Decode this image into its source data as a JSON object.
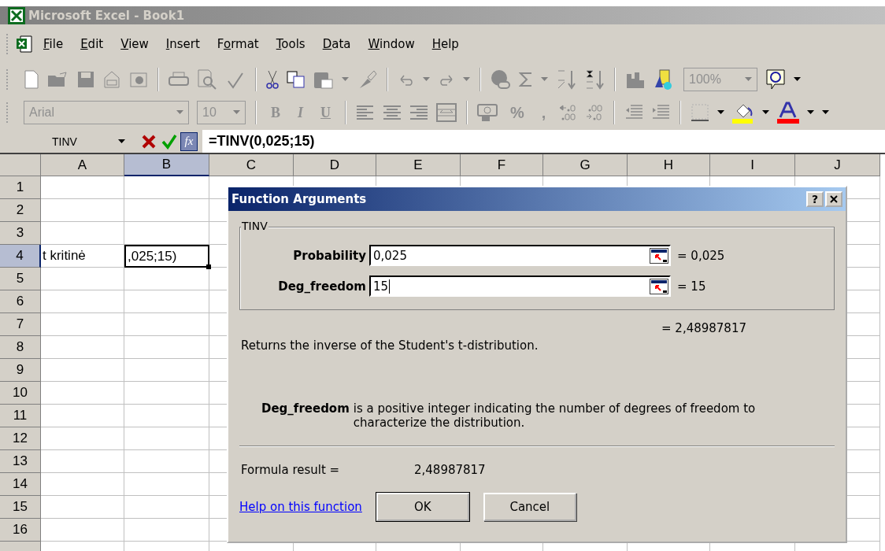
{
  "window": {
    "title": "Microsoft Excel - Book1"
  },
  "menu": [
    {
      "key": "F",
      "post": "ile"
    },
    {
      "key": "E",
      "post": "dit"
    },
    {
      "key": "V",
      "post": "iew"
    },
    {
      "key": "I",
      "post": "nsert"
    },
    {
      "pre": "F",
      "key": "o",
      "post": "rmat"
    },
    {
      "key": "T",
      "post": "ools"
    },
    {
      "key": "D",
      "post": "ata"
    },
    {
      "key": "W",
      "post": "indow"
    },
    {
      "key": "H",
      "post": "elp"
    }
  ],
  "standard_toolbar": {
    "zoom": "100%"
  },
  "formatting_toolbar": {
    "font": "Arial",
    "size": "10",
    "style_buttons": [
      "B",
      "I",
      "U"
    ],
    "percent": "%",
    "comma": ","
  },
  "formula_bar": {
    "name_box": "TINV",
    "insert_function": "fx",
    "formula": "=TINV(0,025;15)"
  },
  "sheet": {
    "columns": [
      {
        "label": "A",
        "selected": false
      },
      {
        "label": "B",
        "selected": true
      },
      {
        "label": "C",
        "selected": false
      },
      {
        "label": "D",
        "selected": false
      },
      {
        "label": "E",
        "selected": false
      },
      {
        "label": "F",
        "selected": false
      },
      {
        "label": "G",
        "selected": false
      },
      {
        "label": "H",
        "selected": false
      },
      {
        "label": "I",
        "selected": false
      },
      {
        "label": "J",
        "selected": false
      }
    ],
    "rows": [
      {
        "label": "1",
        "selected": false
      },
      {
        "label": "2",
        "selected": false
      },
      {
        "label": "3",
        "selected": false
      },
      {
        "label": "4",
        "selected": true,
        "cells": [
          {
            "text": "t kritinė",
            "active": false
          },
          {
            "text": ",025;15)",
            "active": true
          }
        ]
      },
      {
        "label": "5",
        "selected": false
      },
      {
        "label": "6",
        "selected": false
      },
      {
        "label": "7",
        "selected": false
      },
      {
        "label": "8",
        "selected": false
      },
      {
        "label": "9",
        "selected": false
      },
      {
        "label": "10",
        "selected": false
      },
      {
        "label": "11",
        "selected": false
      },
      {
        "label": "12",
        "selected": false
      },
      {
        "label": "13",
        "selected": false
      },
      {
        "label": "14",
        "selected": false
      },
      {
        "label": "15",
        "selected": false
      },
      {
        "label": "16",
        "selected": false
      }
    ]
  },
  "dialog": {
    "title": "Function Arguments",
    "help_button": "?",
    "function_name": "TINV",
    "arguments": [
      {
        "label": "Probability",
        "value": "0,025",
        "result": "= 0,025",
        "focused": false
      },
      {
        "label": "Deg_freedom",
        "value": "15",
        "result": "= 15",
        "focused": true
      }
    ],
    "result": "= 2,48987817",
    "description": "Returns the inverse of the Student's t-distribution.",
    "argument_help": {
      "name": "Deg_freedom",
      "text": "is a positive integer indicating the number of degrees of freedom to characterize the distribution."
    },
    "formula_result_label": "Formula result =",
    "formula_result": "2,48987817",
    "help_link": "Help on this function",
    "buttons": [
      "OK",
      "Cancel"
    ]
  }
}
